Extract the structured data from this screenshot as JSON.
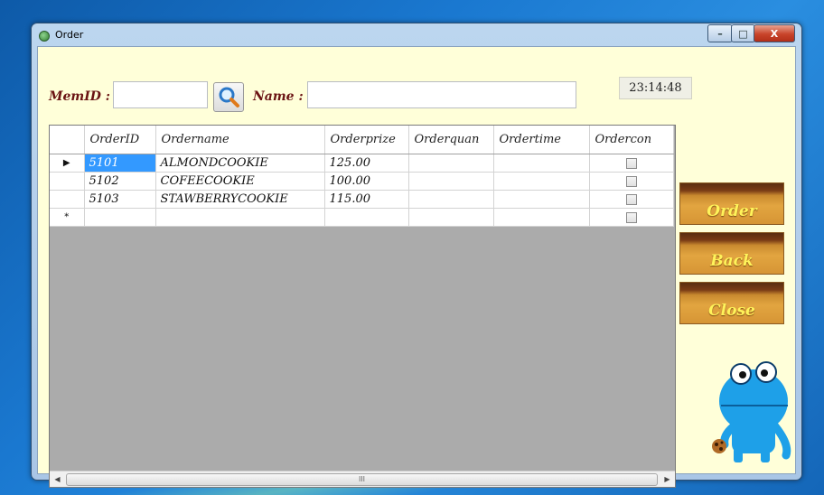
{
  "window": {
    "title": "Order"
  },
  "form": {
    "memid_label": "MemID :",
    "memid_value": "",
    "name_label": "Name :",
    "name_value": "",
    "clock": "23:14:48"
  },
  "grid": {
    "columns": [
      "OrderID",
      "Ordername",
      "Orderprize",
      "Orderquan",
      "Ordertime",
      "Ordercon"
    ],
    "rows": [
      {
        "indicator": "▶",
        "id": "5101",
        "name": "ALMONDCOOKIE",
        "prize": "125.00",
        "quan": "",
        "time": "",
        "con": false
      },
      {
        "indicator": "",
        "id": "5102",
        "name": "COFEECOOKIE",
        "prize": "100.00",
        "quan": "",
        "time": "",
        "con": false
      },
      {
        "indicator": "",
        "id": "5103",
        "name": "STAWBERRYCOOKIE",
        "prize": "115.00",
        "quan": "",
        "time": "",
        "con": false
      },
      {
        "indicator": "*",
        "id": "",
        "name": "",
        "prize": "",
        "quan": "",
        "time": "",
        "con": false
      }
    ],
    "scroll_thumb": "III"
  },
  "buttons": {
    "order": "Order",
    "back": "Back",
    "close": "Close"
  },
  "titlebar_controls": {
    "minimize": "–",
    "maximize": "□",
    "close": "X"
  },
  "colors": {
    "client_bg": "#ffffd9",
    "label": "#6a1313",
    "selection": "#3399ff",
    "button_text": "#fff35a"
  }
}
